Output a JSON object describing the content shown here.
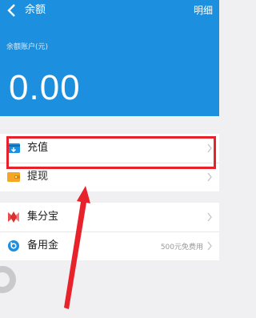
{
  "nav": {
    "title": "余额",
    "detail_label": "明细"
  },
  "balance": {
    "label": "余额账户(元)",
    "amount": "0.00"
  },
  "group1": [
    {
      "label": "充值",
      "icon": "recharge-icon"
    },
    {
      "label": "提现",
      "icon": "withdraw-icon"
    }
  ],
  "group2": [
    {
      "label": "集分宝",
      "icon": "jifenbao-icon"
    },
    {
      "label": "备用金",
      "icon": "beiyongjin-icon",
      "note": "500元免费用"
    }
  ],
  "colors": {
    "header": "#1c8fde",
    "highlight": "#e8222b"
  }
}
